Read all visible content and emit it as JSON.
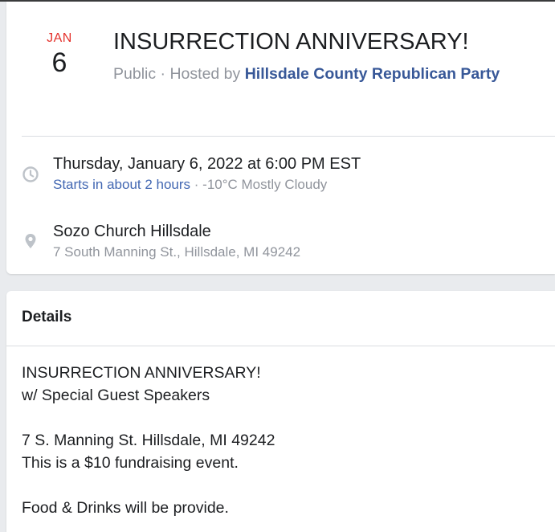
{
  "event": {
    "month": "JAN",
    "day": "6",
    "title": "INSURRECTION ANNIVERSARY!",
    "privacy": "Public",
    "separator": " · ",
    "hosted_by_prefix": "Hosted by ",
    "host_name": "Hillsdale County Republican Party",
    "datetime": "Thursday, January 6, 2022 at 6:00 PM EST",
    "starts_in": "Starts in about 2 hours",
    "weather": " · -10°C Mostly Cloudy",
    "location_name": "Sozo Church Hillsdale",
    "location_address": "7 South Manning St., Hillsdale, MI 49242",
    "icons": {
      "time": "clock-icon",
      "location": "map-pin-icon"
    },
    "colors": {
      "month": "#e4312b",
      "host_link": "#385898",
      "starts_in_link": "#4267b2",
      "secondary_text": "#90949c"
    }
  },
  "details": {
    "heading": "Details",
    "lines": [
      "INSURRECTION ANNIVERSARY!",
      "w/ Special Guest Speakers",
      "",
      "7 S. Manning St. Hillsdale, MI 49242",
      "This is a $10 fundraising event.",
      "",
      "Food & Drinks will be provide."
    ]
  }
}
